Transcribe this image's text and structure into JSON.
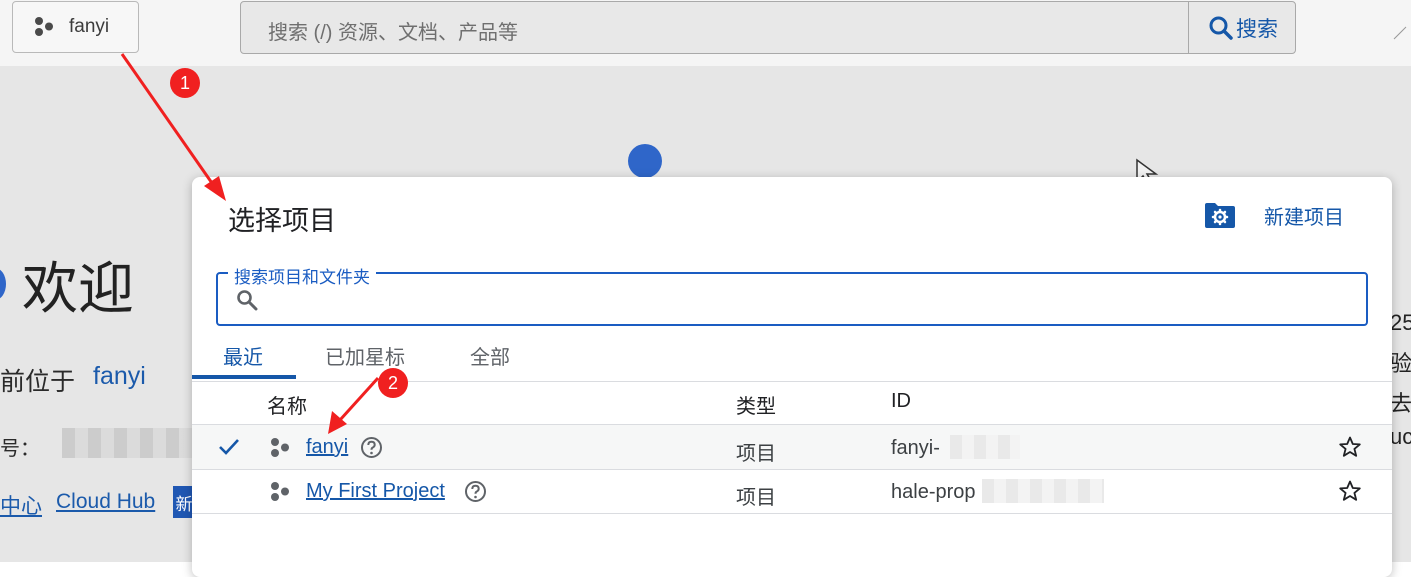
{
  "header": {
    "project_name": "fanyi",
    "search_placeholder": "搜索 (/) 资源、文档、产品等",
    "search_button": "搜索"
  },
  "background": {
    "welcome": "欢迎",
    "location_prefix": "前位于",
    "location_project": "fanyi",
    "id_label": "号：",
    "link_center": "中心",
    "link_cloud_hub": "Cloud Hub",
    "new_badge": "新",
    "right_fragments": [
      "25",
      "验",
      "去",
      "uc"
    ]
  },
  "modal": {
    "title": "选择项目",
    "new_project": "新建项目",
    "search_label": "搜索项目和文件夹",
    "tabs": [
      {
        "label": "最近",
        "active": true
      },
      {
        "label": "已加星标",
        "active": false
      },
      {
        "label": "全部",
        "active": false
      }
    ],
    "columns": {
      "name": "名称",
      "type": "类型",
      "id": "ID"
    },
    "rows": [
      {
        "selected": true,
        "name": "fanyi",
        "type": "项目",
        "id": "fanyi-"
      },
      {
        "selected": false,
        "name": "My First Project",
        "type": "项目",
        "id": "hale-prop"
      }
    ]
  },
  "annotations": [
    "1",
    "2"
  ],
  "colors": {
    "accent": "#1557a8",
    "annotation_red": "#f02020",
    "focus_border": "#1a5cc2"
  }
}
